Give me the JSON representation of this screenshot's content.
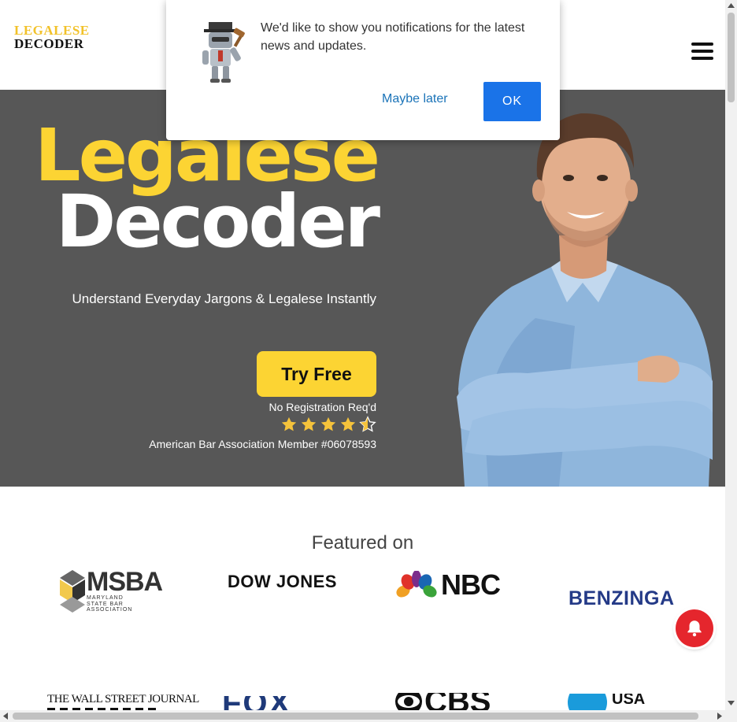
{
  "header": {
    "logo_top": "LEGALESE",
    "logo_bottom": "DECODER",
    "menu_icon": "hamburger-menu-icon"
  },
  "notification": {
    "message": "We'd like to show you notifications for the latest news and updates.",
    "maybe_label": "Maybe later",
    "ok_label": "OK",
    "icon": "robot-judge-icon"
  },
  "hero": {
    "title_line1": "Legalese",
    "title_line2": "Decoder",
    "subtitle": "Understand Everyday Jargons & Legalese Instantly",
    "cta_label": "Try Free",
    "no_registration": "No Registration Req'd",
    "rating": 4.5,
    "rating_max": 5,
    "membership": "American Bar Association Member #06078593"
  },
  "featured": {
    "title": "Featured on",
    "logos": [
      {
        "name": "MSBA",
        "sub": "MARYLAND STATE BAR ASSOCIATION"
      },
      {
        "name": "DOW JONES"
      },
      {
        "name": "NBC"
      },
      {
        "name": "BENZINGA"
      },
      {
        "name": "THE WALL STREET JOURNAL"
      },
      {
        "name": "FOX"
      },
      {
        "name": "CBS"
      },
      {
        "name": "USA"
      }
    ]
  },
  "colors": {
    "brand_yellow": "#fcd433",
    "hero_bg": "#575757",
    "ok_blue": "#1a73e8",
    "bell_red": "#e5262d",
    "benzinga_blue": "#243a87"
  }
}
